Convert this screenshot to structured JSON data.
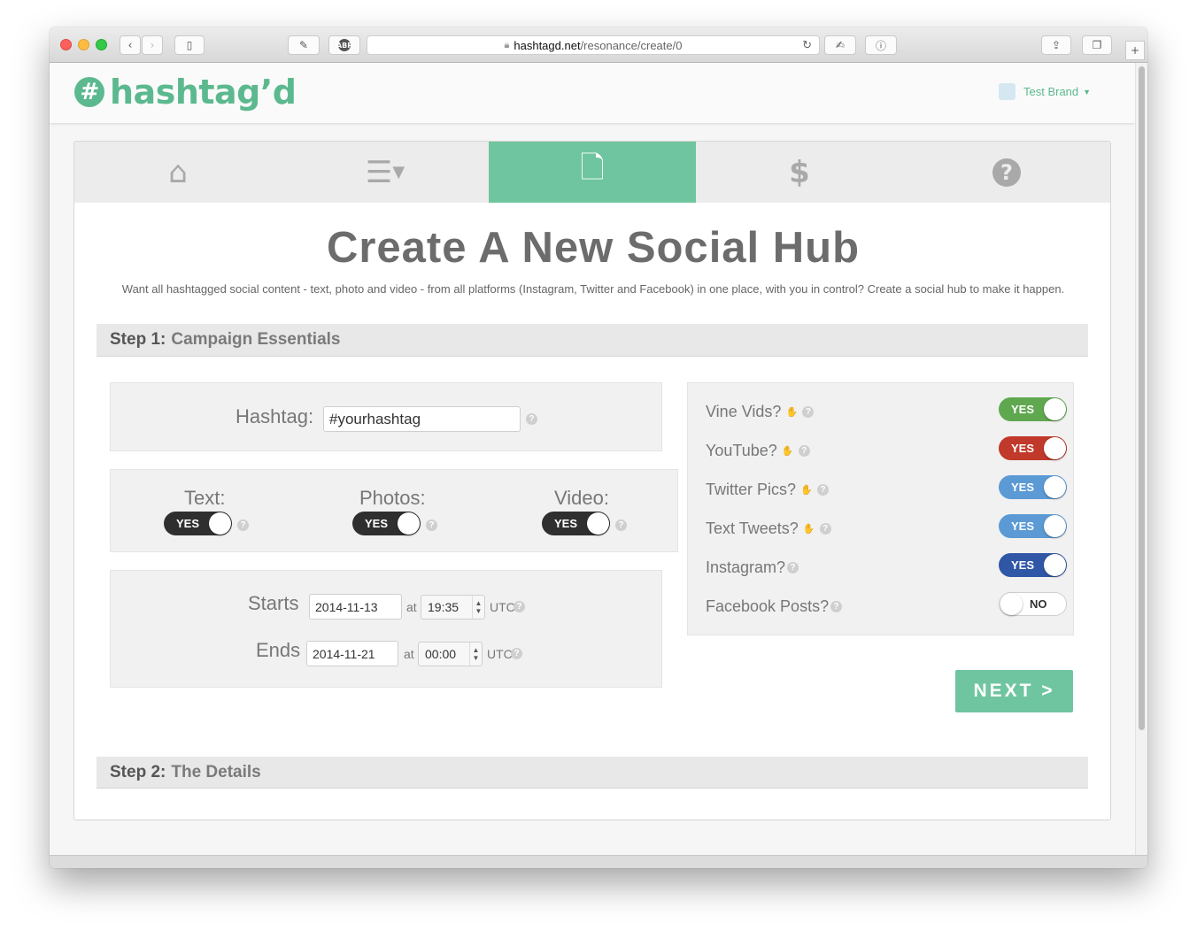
{
  "browser": {
    "url_host": "hashtagd.net",
    "url_path": "/resonance/create/0",
    "icons": [
      "back-icon",
      "forward-icon",
      "sidebar-icon",
      "evernote-icon",
      "adblock-icon",
      "lock-icon",
      "reload-icon",
      "pen-icon",
      "info-icon",
      "share-icon",
      "tabs-icon",
      "plus-icon"
    ]
  },
  "header": {
    "logo_text": "hashtag’d",
    "user_label": "Test Brand",
    "accent": "#5cb98f"
  },
  "nav": {
    "tabs": [
      {
        "icon": "home-icon",
        "active": false
      },
      {
        "icon": "list-icon",
        "active": false
      },
      {
        "icon": "document-icon",
        "active": true
      },
      {
        "icon": "dollar-icon",
        "active": false
      },
      {
        "icon": "question-icon",
        "active": false
      }
    ]
  },
  "page": {
    "title": "Create A New Social Hub",
    "intro": "Want all hashtagged social content - text, photo and video - from all platforms (Instagram, Twitter and Facebook) in one place, with you in control? Create a social hub to make it happen."
  },
  "step1": {
    "num": "Step 1:",
    "name": "Campaign Essentials"
  },
  "step2": {
    "num": "Step 2:",
    "name": "The Details"
  },
  "hashtag": {
    "label": "Hashtag:",
    "value": "#yourhashtag"
  },
  "content_types": {
    "text": {
      "label": "Text:",
      "state": "YES"
    },
    "photos": {
      "label": "Photos:",
      "state": "YES"
    },
    "video": {
      "label": "Video:",
      "state": "YES"
    }
  },
  "schedule": {
    "starts_label": "Starts",
    "starts_date": "2014-11-13",
    "starts_at": "at",
    "starts_time": "19:35",
    "starts_tz": "UTC",
    "ends_label": "Ends",
    "ends_date": "2014-11-21",
    "ends_at": "at",
    "ends_time": "00:00",
    "ends_tz": "UTC"
  },
  "services": [
    {
      "label": "Vine Vids?",
      "state": "YES",
      "color": "#5fa84f",
      "via": true
    },
    {
      "label": "YouTube?",
      "state": "YES",
      "color": "#c0392b",
      "via": true
    },
    {
      "label": "Twitter Pics?",
      "state": "YES",
      "color": "#5b9ad4",
      "via": true
    },
    {
      "label": "Text Tweets?",
      "state": "YES",
      "color": "#5b9ad4",
      "via": true
    },
    {
      "label": "Instagram?",
      "state": "YES",
      "color": "#3056a6",
      "via": false
    },
    {
      "label": "Facebook Posts?",
      "state": "NO",
      "color": "#ffffff",
      "via": false
    }
  ],
  "next_label": "NEXT >"
}
